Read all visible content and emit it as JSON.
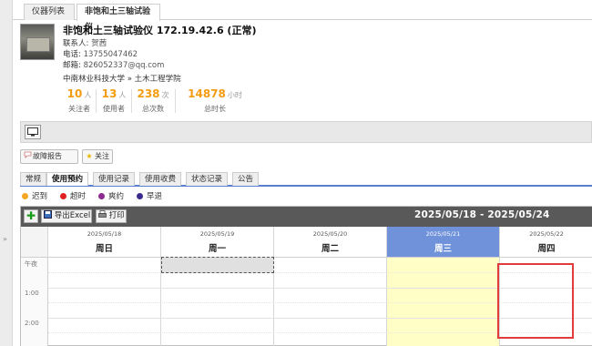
{
  "top_tabs": [
    "仪器列表",
    "非饱和土三轴试验仪"
  ],
  "instrument": {
    "name": "非饱和土三轴试验仪 172.19.42.6 (正常)",
    "contact_label": "联系人:",
    "contact_value": "贺茜",
    "phone_label": "电话:",
    "phone_value": "13755047462",
    "email_label": "邮箱:",
    "email_value": "826052337@qq.com",
    "school": "中南林业科技大学 » 土木工程学院"
  },
  "stats": [
    {
      "num": "10",
      "unit": "人",
      "label": "关注者"
    },
    {
      "num": "13",
      "unit": "人",
      "label": "使用者"
    },
    {
      "num": "238",
      "unit": "次",
      "label": "总次数"
    },
    {
      "num": "14878",
      "unit": "小时",
      "label": "总时长"
    }
  ],
  "actions": {
    "report": "故障报告",
    "follow": "关注"
  },
  "sub_tabs": [
    "常规",
    "使用预约",
    "使用记录",
    "使用收费",
    "状态记录",
    "公告"
  ],
  "legend": [
    {
      "label": "迟到",
      "color": "#f5a623"
    },
    {
      "label": "超时",
      "color": "#e02020"
    },
    {
      "label": "爽约",
      "color": "#8e2a8e"
    },
    {
      "label": "早退",
      "color": "#3a2a8e"
    }
  ],
  "calendar": {
    "export": "导出Excel",
    "print": "打印",
    "range": "2025/05/18 - 2025/05/24",
    "days": [
      {
        "date": "2025/05/18",
        "weekday": "周日"
      },
      {
        "date": "2025/05/19",
        "weekday": "周一"
      },
      {
        "date": "2025/05/20",
        "weekday": "周二"
      },
      {
        "date": "2025/05/21",
        "weekday": "周三"
      },
      {
        "date": "2025/05/22",
        "weekday": "周四"
      }
    ],
    "times": [
      "午夜",
      "1:00",
      "2:00"
    ]
  },
  "gutter_arrow": "»"
}
